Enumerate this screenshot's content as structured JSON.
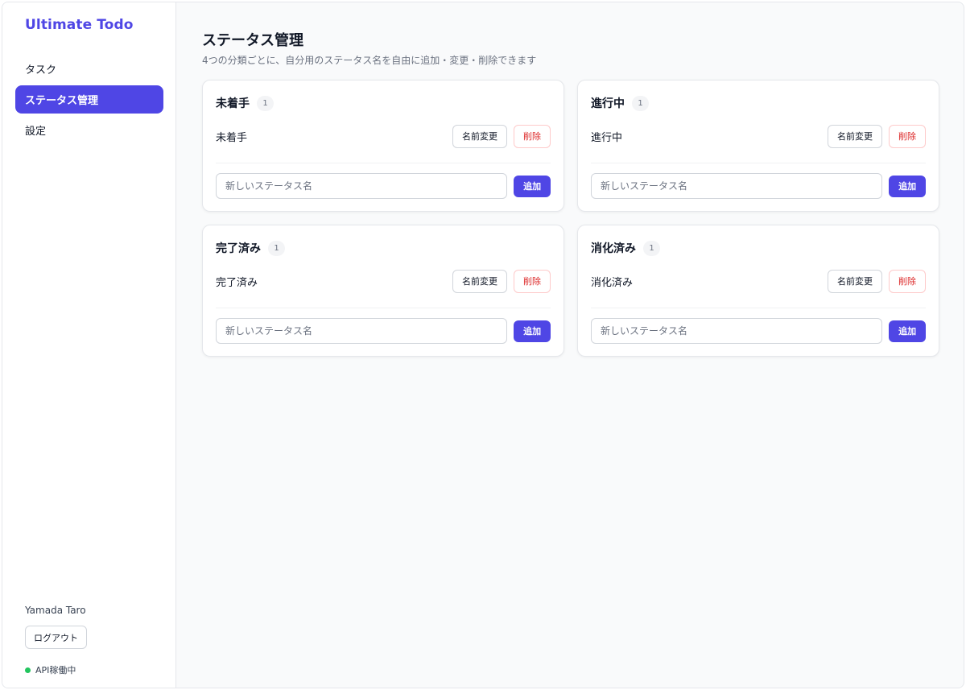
{
  "app": {
    "title": "Ultimate Todo"
  },
  "sidebar": {
    "items": [
      {
        "label": "タスク",
        "active": false
      },
      {
        "label": "ステータス管理",
        "active": true
      },
      {
        "label": "設定",
        "active": false
      }
    ],
    "user_name": "Yamada Taro",
    "logout_label": "ログアウト",
    "api_status": "API稼働中"
  },
  "page": {
    "title": "ステータス管理",
    "subtitle": "4つの分類ごとに、自分用のステータス名を自由に追加・変更・削除できます"
  },
  "categories": [
    {
      "title": "未着手",
      "count": "1",
      "statuses": [
        "未着手"
      ]
    },
    {
      "title": "進行中",
      "count": "1",
      "statuses": [
        "進行中"
      ]
    },
    {
      "title": "完了済み",
      "count": "1",
      "statuses": [
        "完了済み"
      ]
    },
    {
      "title": "消化済み",
      "count": "1",
      "statuses": [
        "消化済み"
      ]
    }
  ],
  "labels": {
    "rename": "名前変更",
    "delete": "削除",
    "add": "追加",
    "new_status_placeholder": "新しいステータス名"
  },
  "colors": {
    "accent": "#4f46e5",
    "danger": "#dc2626",
    "ok": "#22c55e"
  }
}
